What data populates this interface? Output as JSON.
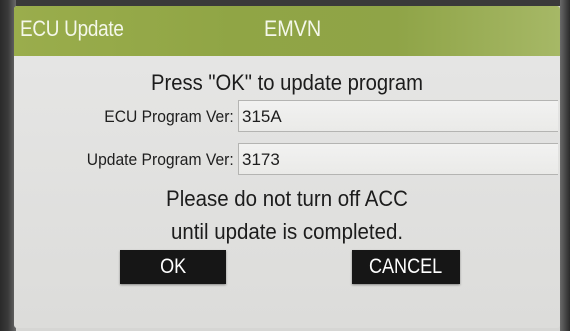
{
  "title_bar": {
    "app_name": "ECU Update",
    "center_label": "EMVN",
    "color": "#93a849"
  },
  "dialog": {
    "prompt": "Press \"OK\" to update program",
    "fields": [
      {
        "label": "ECU Program Ver:",
        "value": "315A"
      },
      {
        "label": "Update Program Ver:",
        "value": "3173"
      }
    ],
    "notice_line1": "Please do not turn off ACC",
    "notice_line2": "until update is completed."
  },
  "buttons": {
    "ok_label": "OK",
    "cancel_label": "CANCEL",
    "color": "#161616"
  }
}
